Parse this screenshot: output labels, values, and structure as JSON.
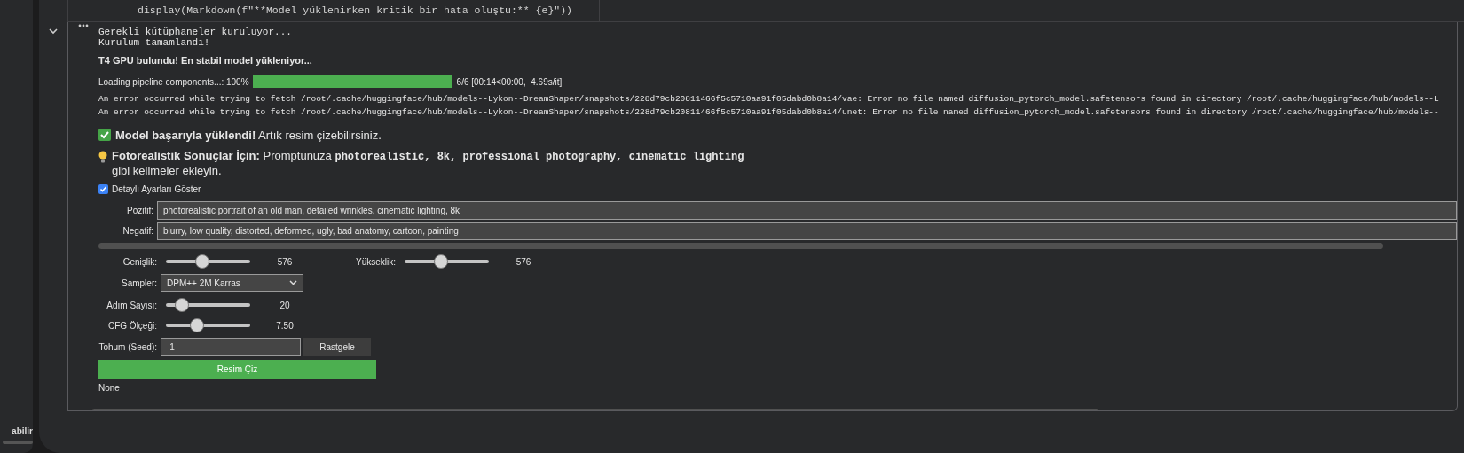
{
  "sidebar": {
    "text": "abilir"
  },
  "code_cell": {
    "line": "display(Markdown(f\"**Model yüklenirken kritik bir hata oluştu:** {e}\"))"
  },
  "output": {
    "expanded": true,
    "log": [
      "Gerekli kütüphaneler kuruluyor...",
      "Kurulum tamamlandı!"
    ],
    "gpu_message": "T4 GPU bulundu! En stabil model yükleniyor...",
    "progress": {
      "label": "Loading pipeline components...: 100%",
      "level": 1,
      "stats": "6/6 [00:14<00:00,  4.69s/it]"
    },
    "errors": [
      "An error occurred while trying to fetch /root/.cache/huggingface/hub/models--Lykon--DreamShaper/snapshots/228d79cb20811466f5c5710aa91f05dabd0b8a14/vae: Error no file named diffusion_pytorch_model.safetensors found in directory /root/.cache/huggingface/hub/models--L",
      "An error occurred while trying to fetch /root/.cache/huggingface/hub/models--Lykon--DreamShaper/snapshots/228d79cb20811466f5c5710aa91f05dabd0b8a14/unet: Error no file named diffusion_pytorch_model.safetensors found in directory /root/.cache/huggingface/hub/models--"
    ],
    "success": "**Model başarıyla yüklendi!** Artık resim çizebilirsiniz.",
    "tip": [
      {
        "kind": "bold",
        "text": "Fotorealistik Sonuçlar İçin:"
      },
      {
        "kind": "plain",
        "text": "Promptunuza"
      },
      {
        "kind": "code",
        "text": "photorealistic, 8k, professional photography, cinematic lighting"
      },
      {
        "kind": "plain",
        "text": "gibi kelimeler ekleyin."
      }
    ],
    "settings": {
      "show_details": {
        "label": "Detaylı Ayarları Göster",
        "checked": true
      },
      "positive": {
        "label": "Pozitif:",
        "value": "photorealistic portrait of an old man, detailed wrinkles, cinematic lighting, 8k"
      },
      "negative": {
        "label": "Negatif:",
        "value": "blurry, low quality, distorted, deformed, ugly, bad anatomy, cartoon, painting"
      },
      "width": {
        "label": "Genişlik:",
        "level": 0.42,
        "reading": "576"
      },
      "height": {
        "label": "Yükseklik:",
        "level": 0.42,
        "reading": "576"
      },
      "sampler": {
        "label": "Sampler:",
        "value": "DPM++ 2M Karras"
      },
      "steps": {
        "label": "Adım Sayısı:",
        "level": 0.16,
        "reading": "20"
      },
      "cfg": {
        "label": "CFG Ölçeği:",
        "level": 0.36,
        "reading": "7.50"
      },
      "seed": {
        "label": "Tohum (Seed):",
        "value": "-1"
      },
      "random_button": "Rastgele",
      "generate_button": "Resim Çiz"
    },
    "result": "None"
  }
}
